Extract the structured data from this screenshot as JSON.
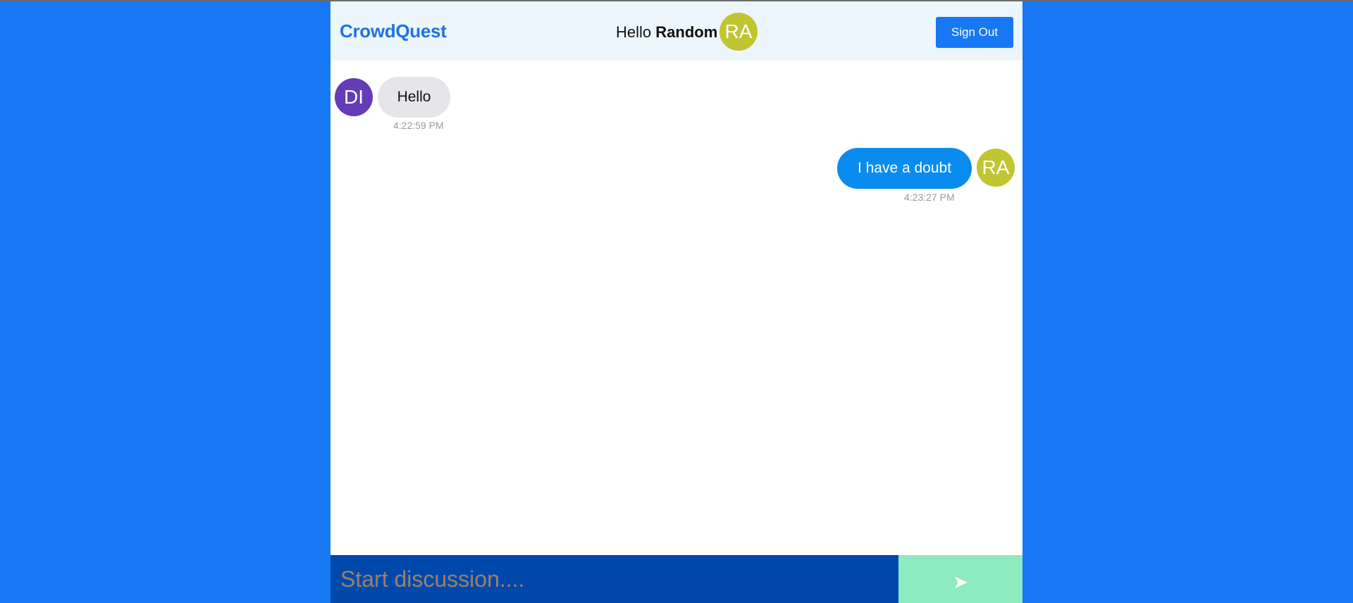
{
  "header": {
    "brand": "CrowdQuest",
    "greeting_prefix": "Hello",
    "user_name": "Random",
    "user_avatar_initials": "RA",
    "sign_out_label": "Sign Out"
  },
  "messages": [
    {
      "direction": "incoming",
      "avatar_initials": "DI",
      "avatar_color": "#653bb8",
      "text": "Hello",
      "time": "4:22:59 PM"
    },
    {
      "direction": "outgoing",
      "avatar_initials": "RA",
      "avatar_color": "#c0c531",
      "text": "I have a doubt",
      "time": "4:23:27 PM"
    }
  ],
  "composer": {
    "placeholder": "Start discussion....",
    "value": "",
    "send_icon": "send-arrow-icon"
  },
  "colors": {
    "page_background": "#1877f2",
    "brand": "#1d72e8",
    "header_background": "#edf6fd",
    "incoming_bubble": "#e6e5ea",
    "outgoing_bubble": "#0a8cef",
    "composer_background": "#0049ab",
    "send_button": "#8eeac1"
  }
}
